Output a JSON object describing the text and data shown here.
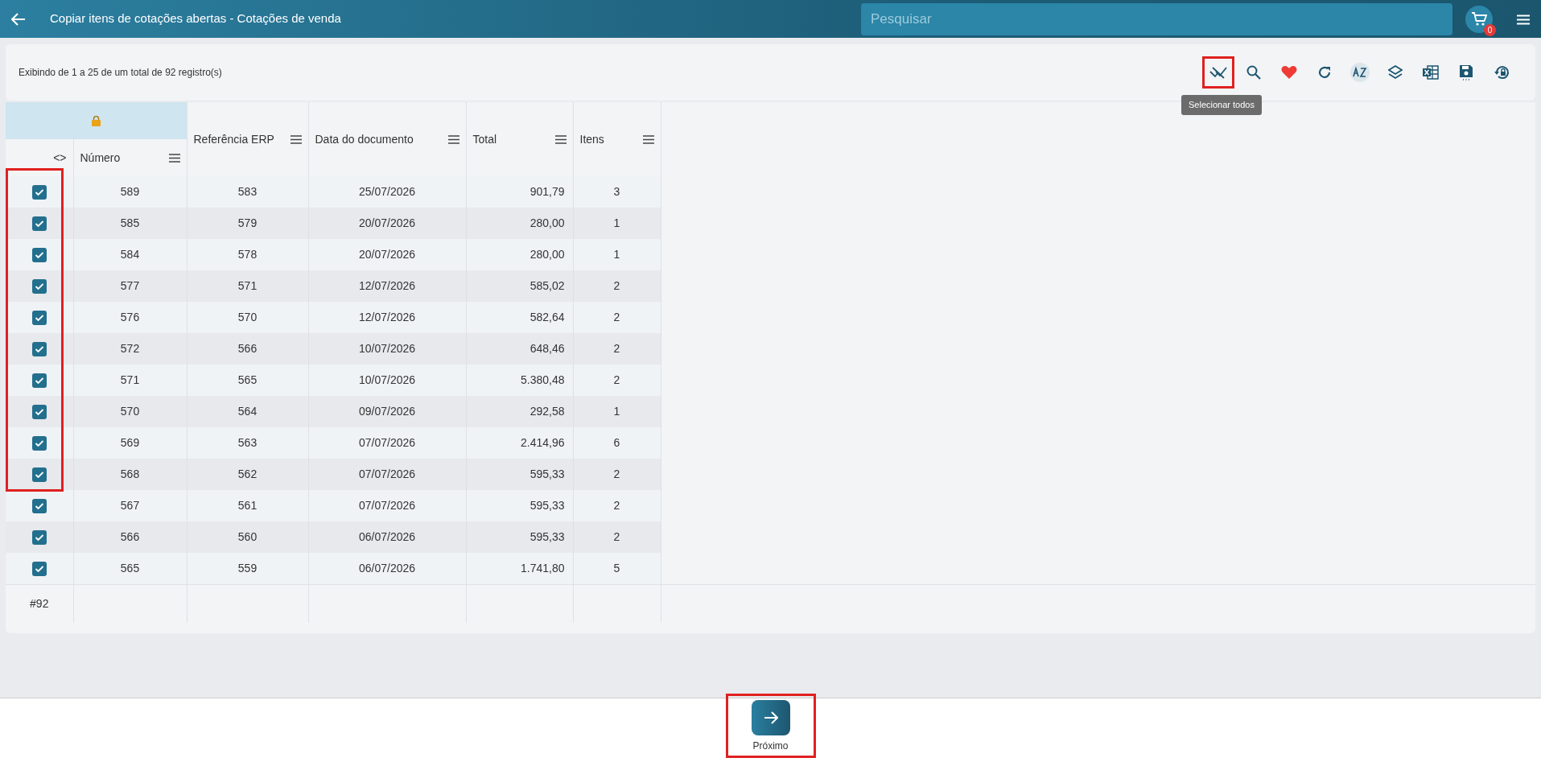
{
  "header": {
    "title": "Copiar itens de cotações abertas - Cotações de venda",
    "search": {
      "placeholder": "Pesquisar"
    },
    "cart_count": "0"
  },
  "toolbar": {
    "summary": "Exibindo de 1 a 25 de um total de 92 registro(s)",
    "tooltip": "Selecionar todos"
  },
  "table": {
    "toggle": "<>",
    "columns": [
      "Número",
      "Referência ERP",
      "Data do documento",
      "Total",
      "Itens"
    ],
    "rows": [
      {
        "selected": true,
        "cells": [
          "589",
          "583",
          "25/07/2026",
          "901,79",
          "3"
        ]
      },
      {
        "selected": true,
        "cells": [
          "585",
          "579",
          "20/07/2026",
          "280,00",
          "1"
        ]
      },
      {
        "selected": true,
        "cells": [
          "584",
          "578",
          "20/07/2026",
          "280,00",
          "1"
        ]
      },
      {
        "selected": true,
        "cells": [
          "577",
          "571",
          "12/07/2026",
          "585,02",
          "2"
        ]
      },
      {
        "selected": true,
        "cells": [
          "576",
          "570",
          "12/07/2026",
          "582,64",
          "2"
        ]
      },
      {
        "selected": true,
        "cells": [
          "572",
          "566",
          "10/07/2026",
          "648,46",
          "2"
        ]
      },
      {
        "selected": true,
        "cells": [
          "571",
          "565",
          "10/07/2026",
          "5.380,48",
          "2"
        ]
      },
      {
        "selected": true,
        "cells": [
          "570",
          "564",
          "09/07/2026",
          "292,58",
          "1"
        ]
      },
      {
        "selected": true,
        "cells": [
          "569",
          "563",
          "07/07/2026",
          "2.414,96",
          "6"
        ]
      },
      {
        "selected": true,
        "cells": [
          "568",
          "562",
          "07/07/2026",
          "595,33",
          "2"
        ]
      },
      {
        "selected": true,
        "cells": [
          "567",
          "561",
          "07/07/2026",
          "595,33",
          "2"
        ]
      },
      {
        "selected": true,
        "cells": [
          "566",
          "560",
          "06/07/2026",
          "595,33",
          "2"
        ]
      },
      {
        "selected": true,
        "cells": [
          "565",
          "559",
          "06/07/2026",
          "1.741,80",
          "5"
        ]
      }
    ],
    "footer": "#92"
  },
  "next_button": {
    "label": "Próximo"
  }
}
